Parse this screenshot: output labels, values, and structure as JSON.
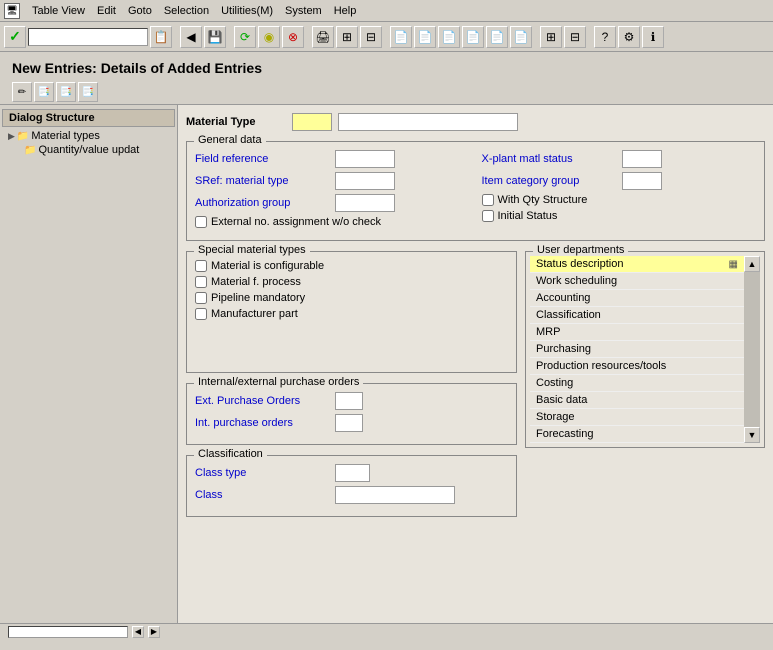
{
  "menubar": {
    "items": [
      "Table View",
      "Edit",
      "Goto",
      "Selection",
      "Utilities(M)",
      "System",
      "Help"
    ]
  },
  "toolbar": {
    "search_placeholder": ""
  },
  "page_title": "New Entries: Details of Added Entries",
  "sub_toolbar_buttons": [
    "🖻",
    "📋",
    "📋",
    "📋"
  ],
  "sidebar": {
    "title": "Dialog Structure",
    "items": [
      {
        "label": "Material types",
        "level": 1,
        "type": "folder",
        "expanded": true
      },
      {
        "label": "Quantity/value updat",
        "level": 2,
        "type": "folder",
        "expanded": false
      }
    ]
  },
  "form": {
    "material_type_label": "Material Type",
    "sections": {
      "general_data": {
        "title": "General data",
        "left_fields": [
          {
            "label": "Field reference",
            "type": "input"
          },
          {
            "label": "SRef: material type",
            "type": "input"
          },
          {
            "label": "Authorization group",
            "type": "input"
          }
        ],
        "left_checkboxes": [
          {
            "label": "External no. assignment w/o check"
          }
        ],
        "right_fields": [
          {
            "label": "X-plant matl status",
            "type": "input-small"
          },
          {
            "label": "Item category group",
            "type": "input-small"
          }
        ],
        "right_checkboxes": [
          {
            "label": "With Qty Structure"
          },
          {
            "label": "Initial Status"
          }
        ]
      },
      "special_material_types": {
        "title": "Special material types",
        "checkboxes": [
          "Material is configurable",
          "Material f. process",
          "Pipeline mandatory",
          "Manufacturer part"
        ]
      },
      "user_departments": {
        "title": "User departments",
        "items": [
          "Status description",
          "Work scheduling",
          "Accounting",
          "Classification",
          "MRP",
          "Purchasing",
          "Production resources/tools",
          "Costing",
          "Basic data",
          "Storage",
          "Forecasting"
        ]
      },
      "internal_external": {
        "title": "Internal/external purchase orders",
        "fields": [
          {
            "label": "Ext. Purchase Orders"
          },
          {
            "label": "Int. purchase orders"
          }
        ]
      },
      "classification": {
        "title": "Classification",
        "fields": [
          {
            "label": "Class type"
          },
          {
            "label": "Class"
          }
        ]
      }
    }
  },
  "status_bar": {
    "text": ""
  }
}
